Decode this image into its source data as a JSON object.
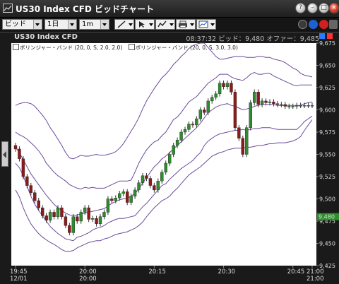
{
  "window": {
    "title": "US30 Index CFD ビッドチャート",
    "buttons": [
      "minimize-button",
      "restore-button",
      "maximize-button",
      "close-button"
    ]
  },
  "toolbar": {
    "price_type": "ビッド",
    "period": "1日",
    "interval": "1m",
    "tools": [
      "draw-line-icon",
      "pointer-icon",
      "indicator-icon",
      "print-icon",
      "chart-type-icon"
    ]
  },
  "info": {
    "symbol": "US30 Index CFD",
    "quote": "08:37:32 ビッド：9,480 オファー：9,485"
  },
  "legend": [
    {
      "label": "ボリンジャー・バンド (20, 0, S, 2.0, 2.0)"
    },
    {
      "label": "ボリンジャー・バンド (20, 0, S, 3.0, 3.0)"
    }
  ],
  "colors": {
    "up": "#2e8b2e",
    "down": "#8b1a1a",
    "band": "#6a4a9a",
    "current": "#2c8f2c"
  },
  "chart_data": {
    "type": "candlestick",
    "y_ticks": [
      "9,675",
      "9,650",
      "9,625",
      "9,600",
      "9,575",
      "9,550",
      "9,525",
      "9,500",
      "9,475",
      "9,450",
      "9,425"
    ],
    "ylim": [
      9425,
      9675
    ],
    "x_ticks": [
      {
        "time": "19:45",
        "date": "12/01"
      },
      {
        "time": "20:00",
        "date": "20:00"
      },
      {
        "time": "20:15",
        "date": ""
      },
      {
        "time": "20:30",
        "date": ""
      },
      {
        "time": "20:45",
        "date": ""
      },
      {
        "time": "21:00",
        "date": "21:00"
      }
    ],
    "current_price": "9,480",
    "close": [
      9556,
      9545,
      9525,
      9515,
      9507,
      9498,
      9490,
      9481,
      9476,
      9485,
      9480,
      9490,
      9480,
      9470,
      9462,
      9480,
      9475,
      9485,
      9490,
      9477,
      9478,
      9472,
      9480,
      9485,
      9500,
      9498,
      9501,
      9506,
      9508,
      9496,
      9503,
      9510,
      9518,
      9526,
      9523,
      9515,
      9510,
      9520,
      9530,
      9540,
      9550,
      9560,
      9566,
      9575,
      9578,
      9584,
      9583,
      9590,
      9600,
      9597,
      9610,
      9614,
      9618,
      9630,
      9626,
      9630,
      9620,
      9580,
      9568,
      9550,
      9580,
      9608,
      9620,
      9606,
      9610,
      9608,
      9609,
      9607,
      9606,
      9606,
      9604,
      9604,
      9604,
      9605,
      9605,
      9605,
      9605,
      9605
    ],
    "bb2_upper": [
      9575,
      9572,
      9570,
      9567,
      9563,
      9559,
      9554,
      9548,
      9540,
      9535,
      9530,
      9526,
      9523,
      9520,
      9516,
      9514,
      9512,
      9511,
      9513,
      9512,
      9513,
      9512,
      9512,
      9512,
      9514,
      9516,
      9518,
      9520,
      9520,
      9520,
      9521,
      9530,
      9540,
      9548,
      9555,
      9560,
      9564,
      9566,
      9571,
      9575,
      9582,
      9589,
      9592,
      9597,
      9603,
      9609,
      9612,
      9615,
      9620,
      9625,
      9630,
      9633,
      9636,
      9640,
      9640,
      9640,
      9637,
      9635,
      9634,
      9633,
      9636,
      9640,
      9642,
      9640,
      9640,
      9641,
      9641,
      9638,
      9636,
      9634,
      9632,
      9630,
      9628,
      9627,
      9628,
      9628,
      9628,
      9628
    ],
    "bb2_lower": [
      9540,
      9535,
      9526,
      9514,
      9503,
      9494,
      9487,
      9481,
      9475,
      9469,
      9465,
      9461,
      9458,
      9455,
      9454,
      9453,
      9457,
      9458,
      9460,
      9462,
      9465,
      9467,
      9468,
      9470,
      9473,
      9475,
      9477,
      9478,
      9478,
      9479,
      9480,
      9481,
      9486,
      9491,
      9495,
      9500,
      9505,
      9510,
      9515,
      9517,
      9522,
      9526,
      9530,
      9534,
      9537,
      9540,
      9543,
      9548,
      9552,
      9560,
      9565,
      9568,
      9571,
      9573,
      9574,
      9575,
      9576,
      9577,
      9577,
      9578,
      9577,
      9578,
      9579,
      9579,
      9580,
      9580,
      9580,
      9579,
      9578,
      9578,
      9578,
      9578,
      9578,
      9578,
      9582,
      9587,
      9590,
      9593
    ],
    "bb3_upper": [
      9605,
      9607,
      9608,
      9608,
      9607,
      9604,
      9599,
      9594,
      9588,
      9580,
      9574,
      9567,
      9560,
      9552,
      9546,
      9545,
      9547,
      9549,
      9548,
      9548,
      9549,
      9550,
      9549,
      9549,
      9550,
      9551,
      9553,
      9557,
      9562,
      9569,
      9576,
      9583,
      9591,
      9601,
      9610,
      9617,
      9624,
      9630,
      9636,
      9640,
      9645,
      9651,
      9655,
      9660,
      9664,
      9669,
      9672,
      9674,
      9675,
      9675,
      9670,
      9665,
      9660,
      9657,
      9657,
      9658,
      9659,
      9660,
      9660,
      9660,
      9659,
      9659,
      9659,
      9660,
      9660,
      9659,
      9659,
      9657,
      9656,
      9655,
      9653,
      9650,
      9647,
      9645,
      9641,
      9639,
      9638,
      9637
    ],
    "bb3_lower": [
      9510,
      9502,
      9490,
      9480,
      9472,
      9466,
      9461,
      9457,
      9454,
      9451,
      9449,
      9446,
      9443,
      9441,
      9441,
      9442,
      9445,
      9447,
      9449,
      9451,
      9452,
      9453,
      9453,
      9455,
      9456,
      9458,
      9460,
      9461,
      9462,
      9463,
      9465,
      9467,
      9470,
      9474,
      9480,
      9485,
      9490,
      9494,
      9498,
      9500,
      9503,
      9508,
      9512,
      9517,
      9522,
      9527,
      9530,
      9533,
      9536,
      9540,
      9544,
      9548,
      9550,
      9552,
      9553,
      9555,
      9556,
      9557,
      9557,
      9557,
      9558,
      9558,
      9559,
      9560,
      9560,
      9561,
      9562,
      9562,
      9563,
      9563,
      9563,
      9564,
      9565,
      9567,
      9570,
      9577,
      9583,
      9589
    ],
    "middle": [
      9558,
      9552,
      9544,
      9536,
      9528,
      9522,
      9516,
      9510,
      9504,
      9499,
      9494,
      9490,
      9487,
      9484,
      9482,
      9481,
      9482,
      9483,
      9484,
      9485,
      9486,
      9487,
      9488,
      9489,
      9492,
      9495,
      9497,
      9499,
      9500,
      9501,
      9503,
      9506,
      9511,
      9518,
      9524,
      9530,
      9536,
      9540,
      9545,
      9548,
      9552,
      9556,
      9560,
      9564,
      9568,
      9572,
      9576,
      9580,
      9585,
      9591,
      9597,
      9600,
      9603,
      9605,
      9606,
      9607,
      9605,
      9604,
      9602,
      9600,
      9601,
      9602,
      9604,
      9605,
      9606,
      9606,
      9606,
      9606,
      9605,
      9605,
      9605,
      9605,
      9605,
      9605,
      9605,
      9607,
      9608,
      9609
    ]
  }
}
